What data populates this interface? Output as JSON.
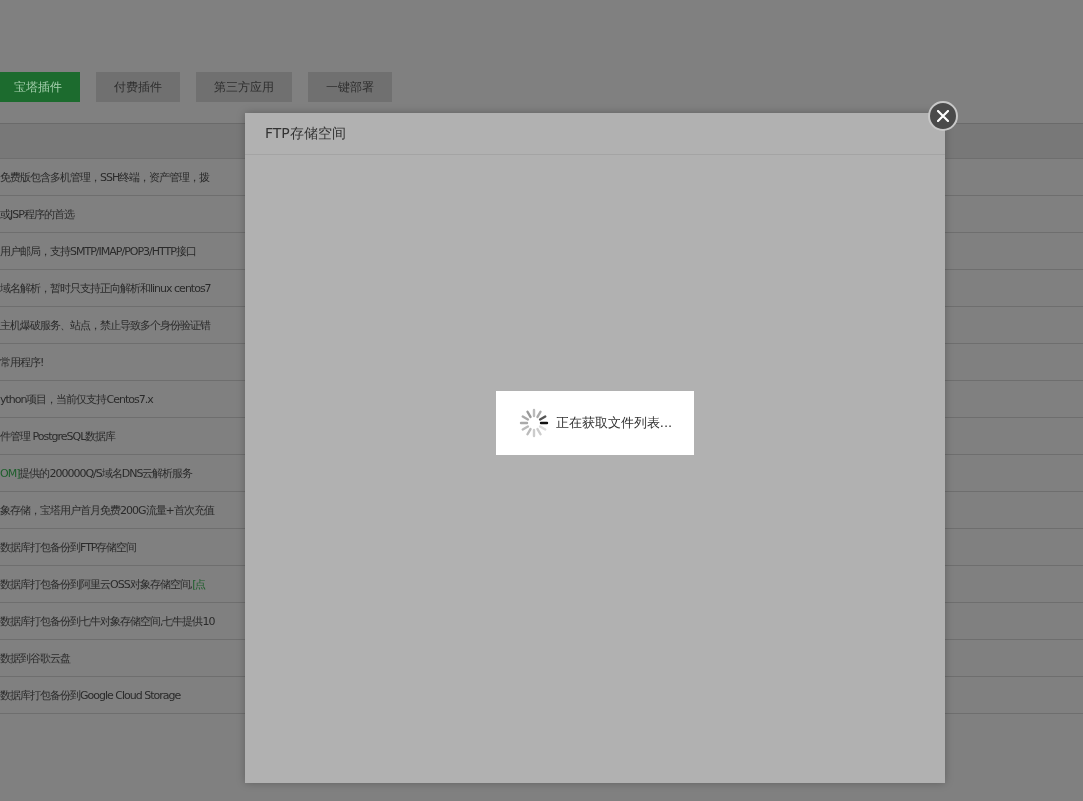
{
  "tabs": [
    {
      "label": "宝塔插件",
      "selected": true
    },
    {
      "label": "付费插件",
      "selected": false
    },
    {
      "label": "第三方应用",
      "selected": false
    },
    {
      "label": "一键部署",
      "selected": false
    }
  ],
  "rows": [
    {
      "text": "免费版包含多机管理，SSH终端，资产管理，拨"
    },
    {
      "text": "或JSP程序的首选"
    },
    {
      "text": "用户邮局，支持SMTP/IMAP/POP3/HTTP接口"
    },
    {
      "text": "域名解析，暂时只支持正向解析和linux centos7"
    },
    {
      "text": "主机爆破服务、站点，禁止导致多个身份验证错"
    },
    {
      "text": "常用程序!"
    },
    {
      "text": "ython项目，当前仅支持Centos7.x"
    },
    {
      "text": "件管理 PostgreSQL数据库"
    },
    {
      "link": "OM]",
      "text": "提供的200000Q/S域名DNS云解析服务"
    },
    {
      "text": "象存储，宝塔用户首月免费200G流量+首次充值"
    },
    {
      "text": "数据库打包备份到FTP存储空间"
    },
    {
      "text": "数据库打包备份到阿里云OSS对象存储空间, ",
      "link_after": "[点"
    },
    {
      "text": "数据库打包备份到七牛对象存储空间,七牛提供10"
    },
    {
      "text": "数据到谷歌云盘"
    },
    {
      "text": "数据库打包备份到Google Cloud Storage"
    }
  ],
  "dialog": {
    "title": "FTP存储空间",
    "loading": "正在获取文件列表..."
  }
}
